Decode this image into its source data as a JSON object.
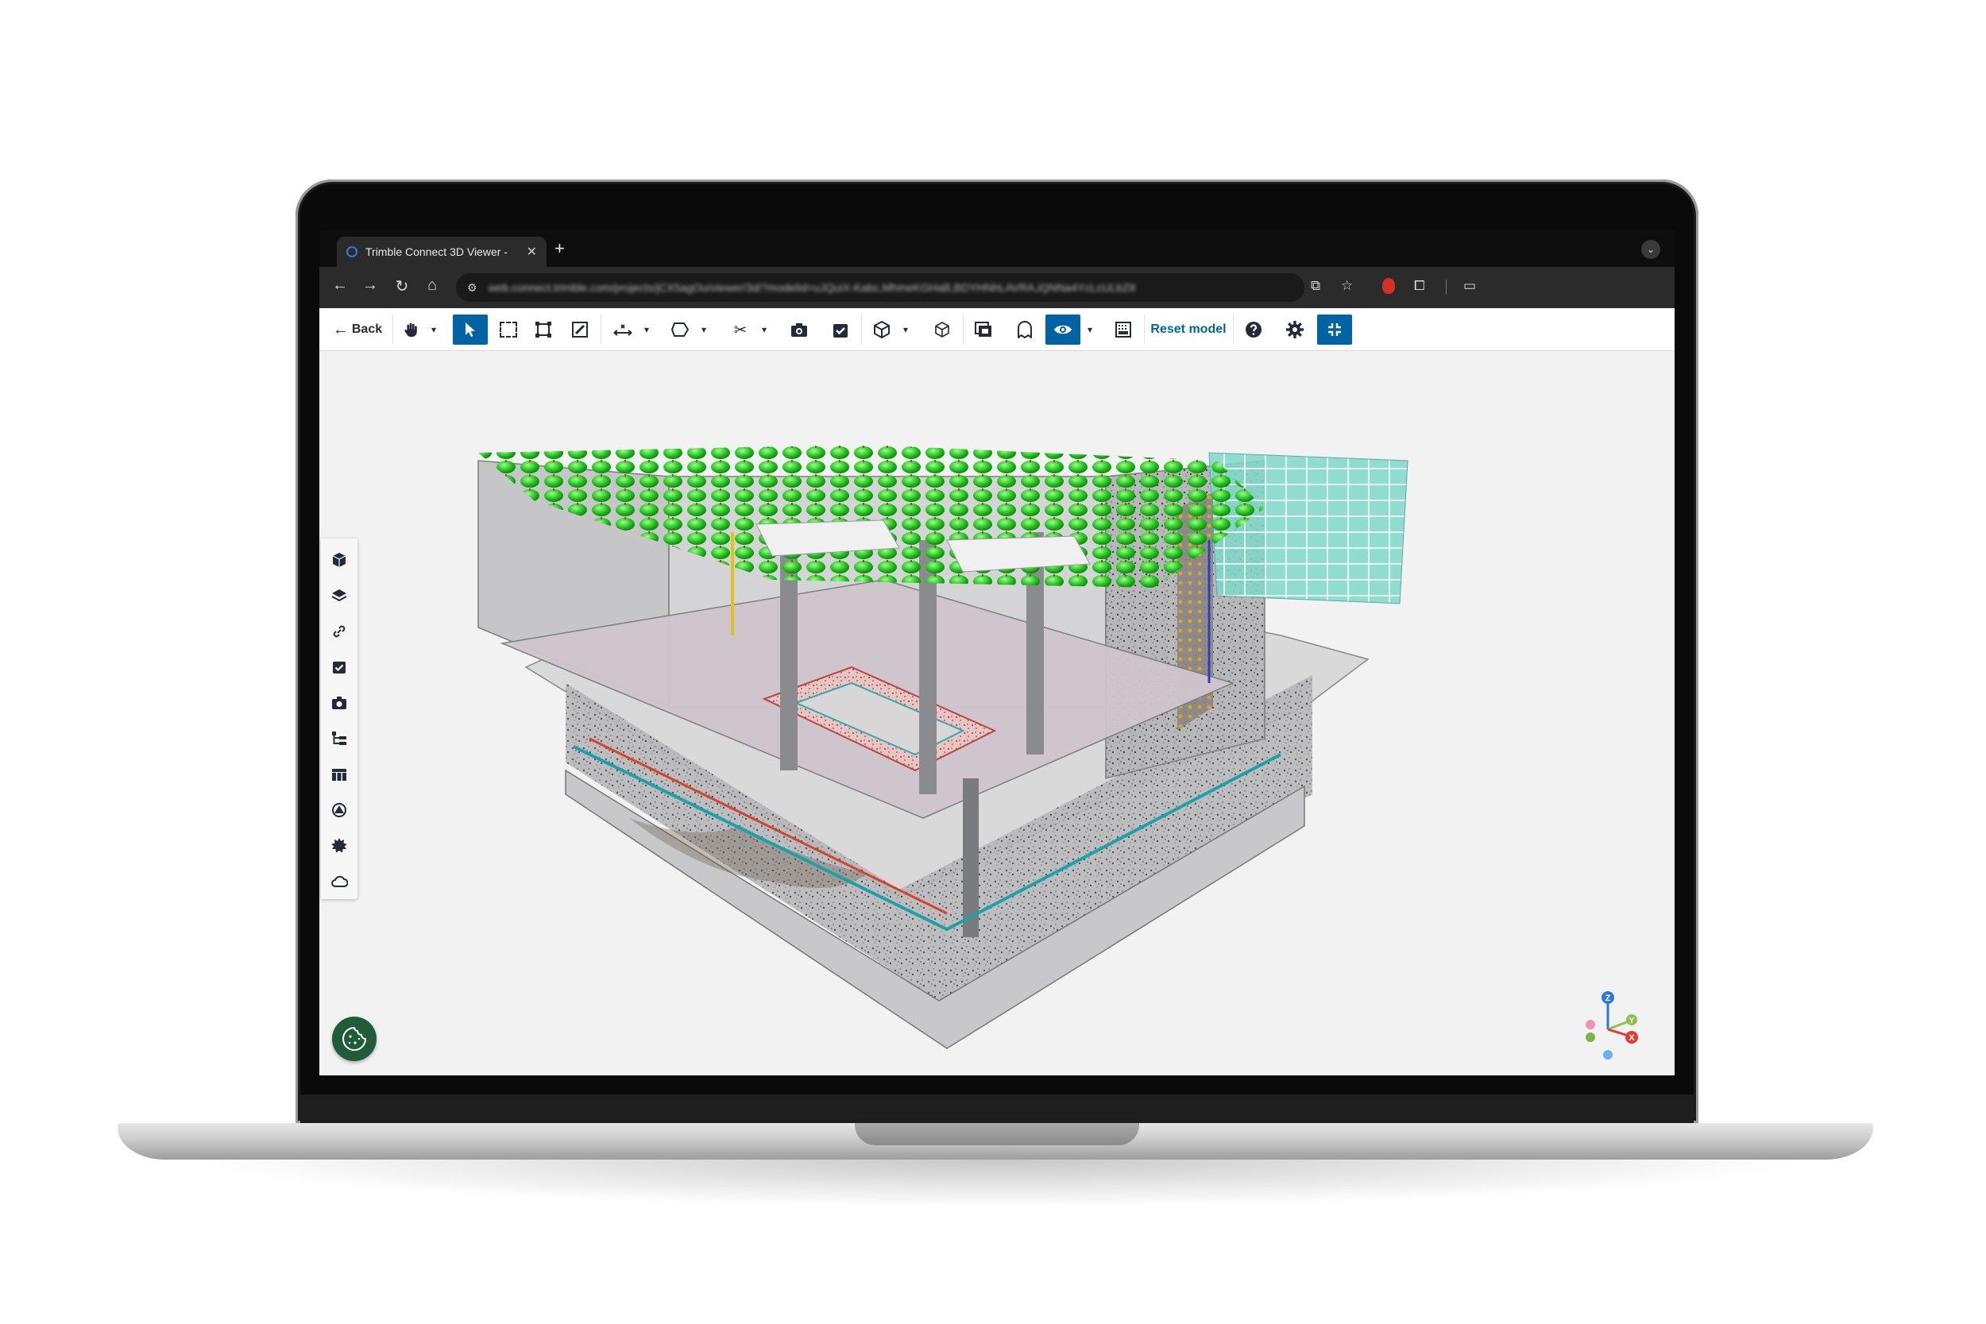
{
  "browser": {
    "tab_title": "Trimble Connect 3D Viewer -",
    "tab_close": "✕",
    "new_tab": "+",
    "tab_menu": "⌄",
    "url": "web.connect.trimble.com/projects/jCX5agOu/viewer/3d/?modelId=uJQuiX-Kabc,MhmeKGHaB,BDYHNhLAVRA,iQNNa4YcLcULbZ8",
    "nav": {
      "back": "←",
      "forward": "→",
      "reload": "↻",
      "home": "⌂"
    },
    "tune_icon": "⚙"
  },
  "toolbar": {
    "back_label": "Back",
    "reset_label": "Reset model",
    "dropdown_glyph": "▾"
  },
  "colors": {
    "accent": "#0063a3",
    "toolbar_icon": "#252a3a",
    "cookie_button": "#1f5c3a",
    "viewport_bg": "#f2f2f2"
  },
  "sidebar": {
    "items": [
      {
        "name": "model-cube-icon"
      },
      {
        "name": "layers-icon"
      },
      {
        "name": "link-icon"
      },
      {
        "name": "todo-check-icon"
      },
      {
        "name": "camera-views-icon"
      },
      {
        "name": "tree-structure-icon"
      },
      {
        "name": "table-icon"
      },
      {
        "name": "clash-icon"
      },
      {
        "name": "settings-burst-icon"
      },
      {
        "name": "cloud-icon"
      }
    ]
  },
  "axes": {
    "z": "Z",
    "y": "Y",
    "x": "X"
  }
}
